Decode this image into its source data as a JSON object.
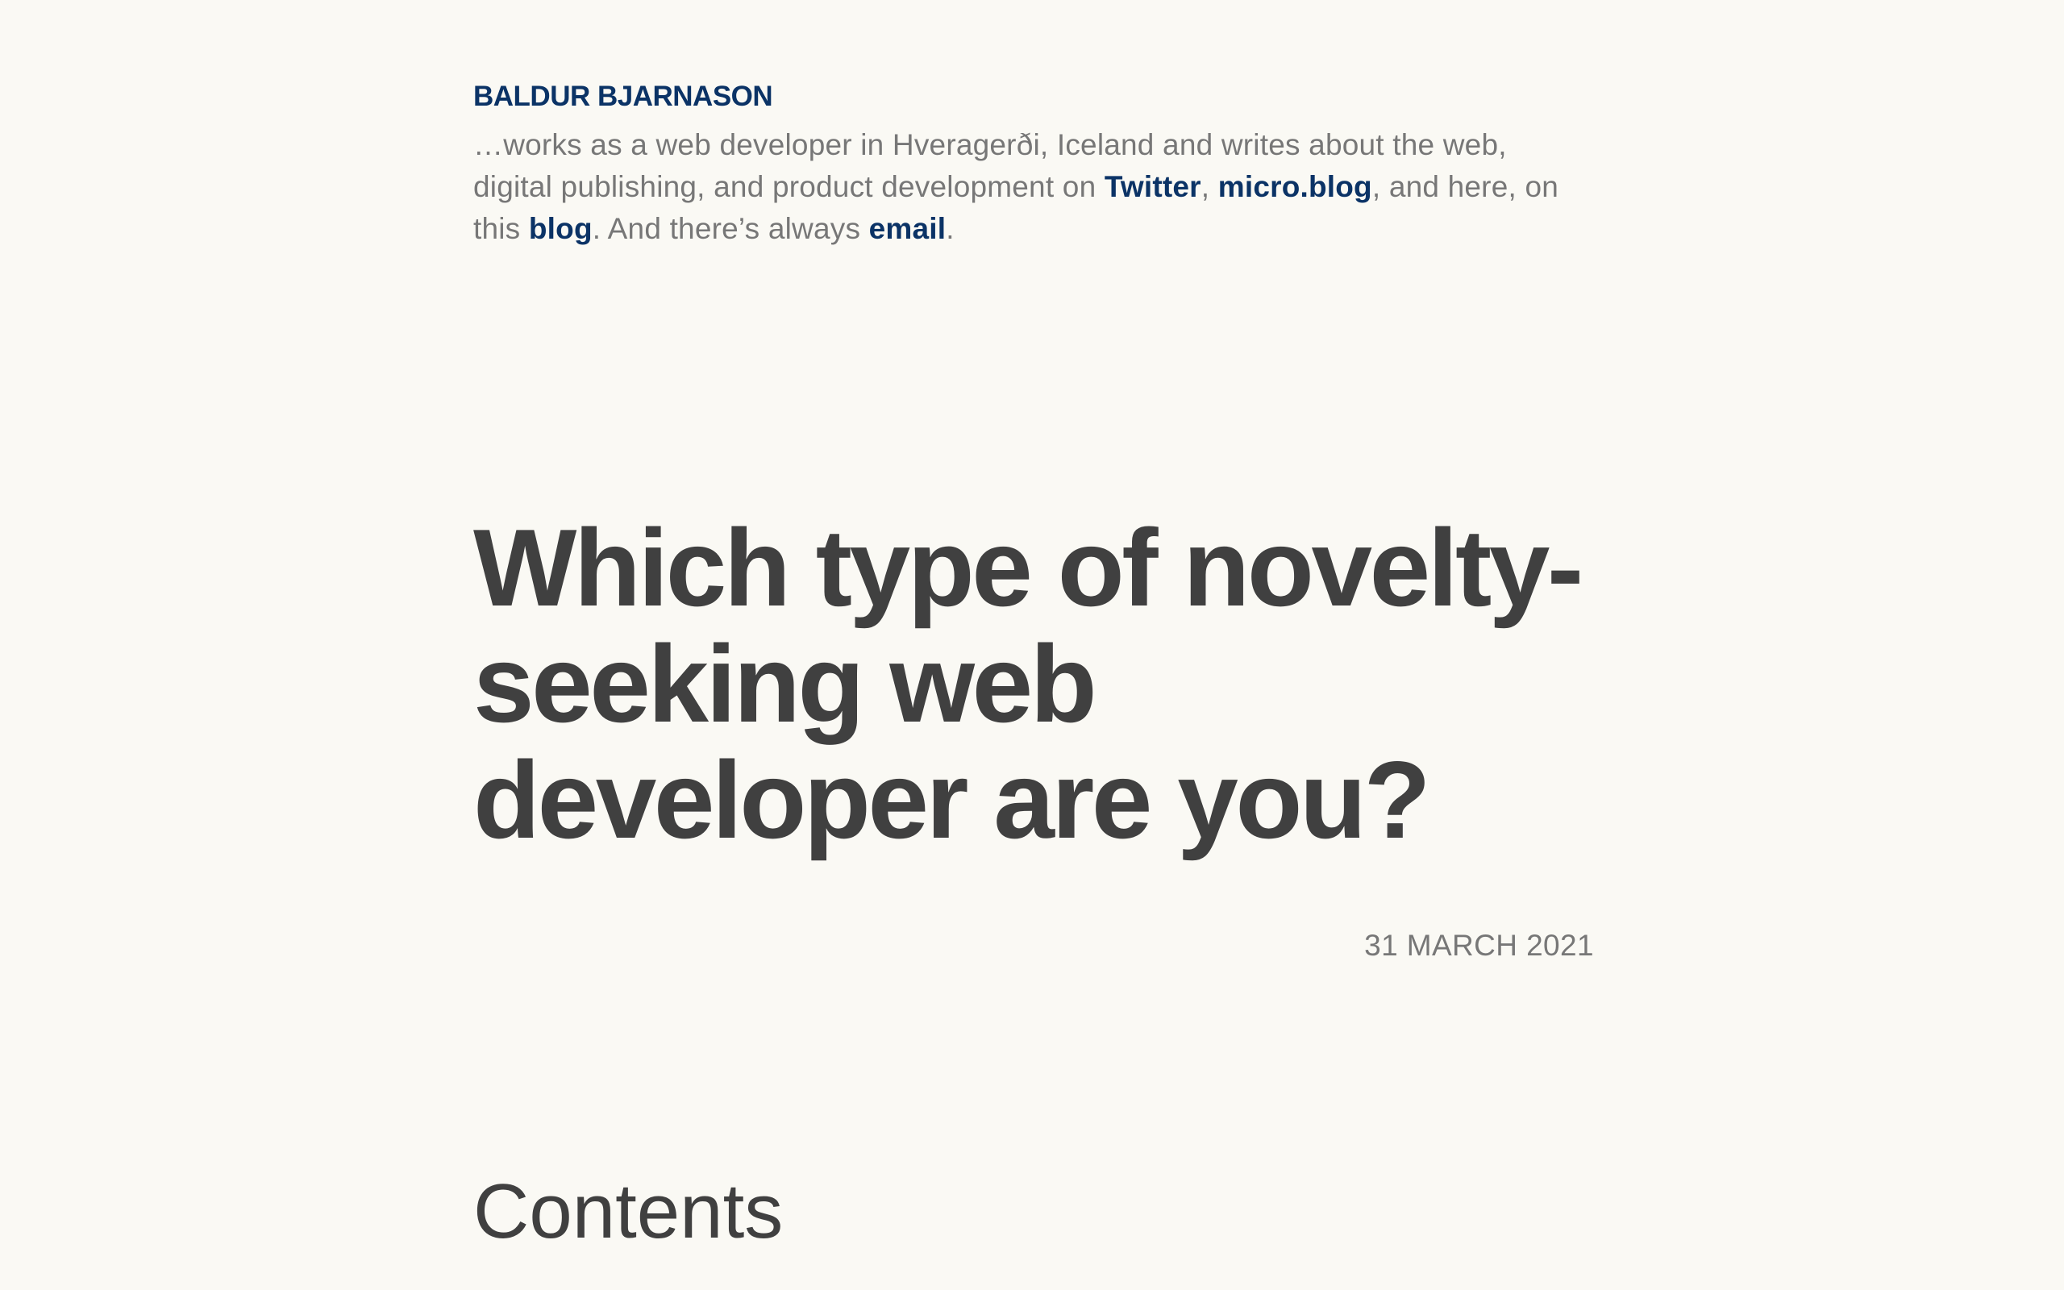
{
  "header": {
    "site_name": "BALDUR BJARNASON",
    "bio": {
      "part1": "…works as a web developer in Hveragerði, Iceland and writes about the web, digital publishing, and product development on ",
      "twitter_link": "Twitter",
      "part2": ", ",
      "microblog_link": "micro.blog",
      "part3": ", and here, on this ",
      "blog_link": "blog",
      "part4": ". And there’s always ",
      "email_link": "email",
      "part5": "."
    }
  },
  "article": {
    "title": "Which type of novelty-seeking web developer are you?",
    "date": "31 MARCH 2021",
    "contents_heading": "Contents"
  },
  "colors": {
    "background": "#faf9f4",
    "link": "#0b3366",
    "heading": "#404040",
    "body_text": "#777777"
  }
}
